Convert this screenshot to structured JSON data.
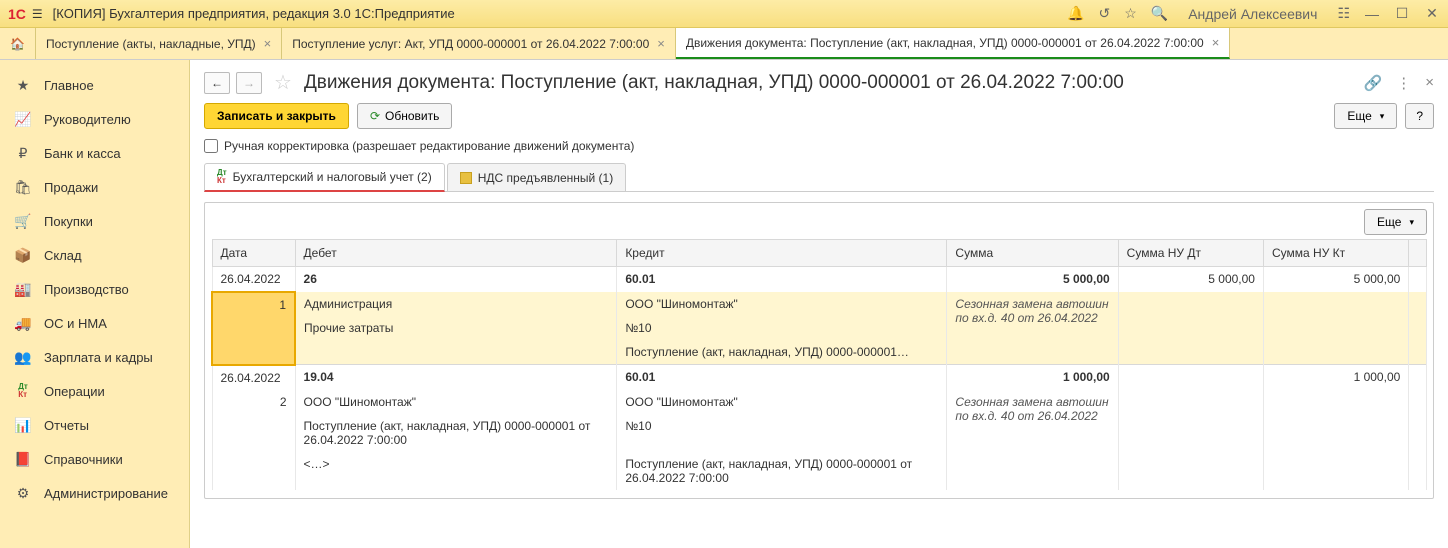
{
  "titlebar": {
    "app_title": "[КОПИЯ] Бухгалтерия предприятия, редакция 3.0 1С:Предприятие",
    "user": "Андрей Алексеевич"
  },
  "tabs": [
    {
      "label": "Поступление (акты, накладные, УПД)"
    },
    {
      "label": "Поступление услуг: Акт, УПД 0000-000001 от 26.04.2022 7:00:00"
    },
    {
      "label": "Движения документа: Поступление (акт, накладная, УПД) 0000-000001 от 26.04.2022 7:00:00"
    }
  ],
  "sidebar": {
    "items": [
      {
        "label": "Главное"
      },
      {
        "label": "Руководителю"
      },
      {
        "label": "Банк и касса"
      },
      {
        "label": "Продажи"
      },
      {
        "label": "Покупки"
      },
      {
        "label": "Склад"
      },
      {
        "label": "Производство"
      },
      {
        "label": "ОС и НМА"
      },
      {
        "label": "Зарплата и кадры"
      },
      {
        "label": "Операции"
      },
      {
        "label": "Отчеты"
      },
      {
        "label": "Справочники"
      },
      {
        "label": "Администрирование"
      }
    ]
  },
  "page": {
    "title": "Движения документа: Поступление (акт, накладная, УПД) 0000-000001 от 26.04.2022 7:00:00",
    "save_close": "Записать и закрыть",
    "refresh": "Обновить",
    "more": "Еще",
    "help": "?",
    "manual_edit": "Ручная корректировка (разрешает редактирование движений документа)"
  },
  "inner_tabs": [
    {
      "label": "Бухгалтерский и налоговый учет (2)"
    },
    {
      "label": "НДС предъявленный (1)"
    }
  ],
  "table": {
    "more": "Еще",
    "headers": {
      "date": "Дата",
      "debit": "Дебет",
      "credit": "Кредит",
      "sum": "Сумма",
      "sum_nu_dt": "Сумма НУ Дт",
      "sum_nu_kt": "Сумма НУ Кт"
    },
    "rows": [
      {
        "date": "26.04.2022",
        "idx": "1",
        "debit_account": "26",
        "credit_account": "60.01",
        "sum": "5 000,00",
        "nu_dt": "5 000,00",
        "nu_kt": "5 000,00",
        "debit_sub1": "Администрация",
        "debit_sub2": "Прочие затраты",
        "credit_sub1": "ООО \"Шиномонтаж\"",
        "credit_sub2": "№10",
        "credit_sub3": "Поступление (акт, накладная, УПД) 0000-000001…",
        "comment": "Сезонная замена автошин по вх.д. 40 от 26.04.2022"
      },
      {
        "date": "26.04.2022",
        "idx": "2",
        "debit_account": "19.04",
        "credit_account": "60.01",
        "sum": "1 000,00",
        "nu_dt": "",
        "nu_kt": "1 000,00",
        "debit_sub1": "ООО \"Шиномонтаж\"",
        "debit_sub2": "Поступление (акт, накладная, УПД) 0000-000001 от 26.04.2022 7:00:00",
        "debit_sub3": "<…>",
        "credit_sub1": "ООО \"Шиномонтаж\"",
        "credit_sub2": "№10",
        "credit_sub3": "Поступление (акт, накладная, УПД) 0000-000001 от 26.04.2022 7:00:00",
        "comment": "Сезонная замена автошин по вх.д. 40 от 26.04.2022"
      }
    ]
  }
}
